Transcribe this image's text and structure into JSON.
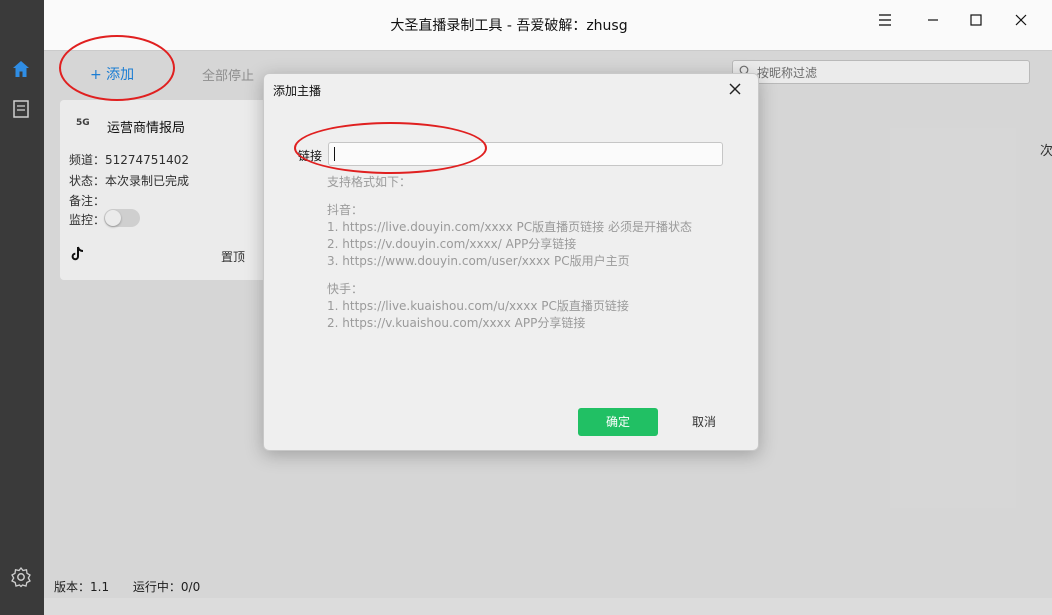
{
  "window": {
    "title": "大圣直播录制工具 - 吾爱破解：zhusg"
  },
  "toolbar": {
    "add_label": "+ 添加",
    "stop_all_label": "全部停止"
  },
  "search": {
    "placeholder": "按昵称过滤"
  },
  "card": {
    "name": "运营商情报局",
    "logo_text": "5G",
    "channel": "频道：51274751402",
    "status": "状态：本次录制已完成",
    "note": "备注：",
    "monitor_label": "监控：",
    "pin_label": "置顶",
    "monitor_on": false
  },
  "statusbar": {
    "version": "版本：1.1",
    "running": "运行中：0/0"
  },
  "edge_text": "次",
  "dialog": {
    "title": "添加主播",
    "link_label": "链接",
    "link_value": "",
    "help_title": "支持格式如下：",
    "douyin_title": "抖音：",
    "douyin_1": "1. https://live.douyin.com/xxxx PC版直播页链接 必须是开播状态",
    "douyin_2": "2. https://v.douyin.com/xxxx/ APP分享链接",
    "douyin_3": "3. https://www.douyin.com/user/xxxx PC版用户主页",
    "kuaishou_title": "快手：",
    "kuaishou_1": "1. https://live.kuaishou.com/u/xxxx PC版直播页链接",
    "kuaishou_2": "2. https://v.kuaishou.com/xxxx APP分享链接",
    "ok_label": "确定",
    "cancel_label": "取消"
  },
  "colors": {
    "accent": "#1e88e5",
    "ok_button": "#21c064",
    "annotation": "#e02020"
  },
  "icons": {
    "rail": [
      "home-icon",
      "document-icon",
      "settings-icon"
    ],
    "window": [
      "menu-icon",
      "minimize-icon",
      "maximize-icon",
      "close-icon"
    ]
  }
}
